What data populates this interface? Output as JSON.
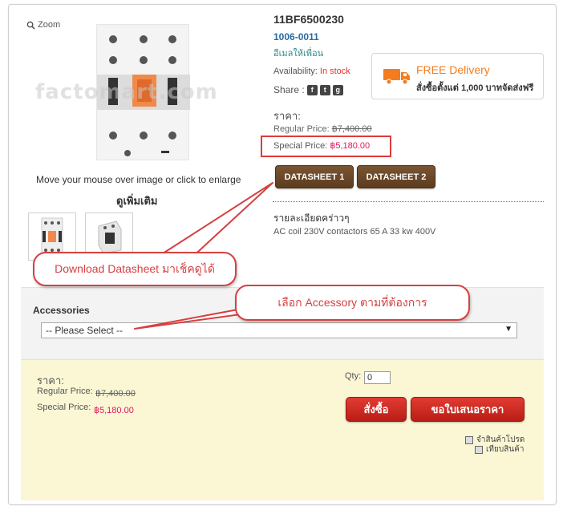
{
  "image": {
    "zoom_label": "Zoom",
    "watermark": "factomart.com",
    "enlarge_hint": "Move your mouse over image or click to enlarge",
    "more_link": "ดูเพิ่มเติม"
  },
  "product": {
    "sku": "11BF6500230",
    "code": "1006-0011",
    "email_friend": "อีเมลให้เพื่อน",
    "availability_label": "Availability:",
    "availability_value": "In stock",
    "share_label": "Share :",
    "price_heading": "ราคา:",
    "regular_label": "Regular Price:",
    "regular_value": "฿7,400.00",
    "special_label": "Special Price:",
    "special_value": "฿5,180.00"
  },
  "delivery": {
    "title": "FREE Delivery",
    "subtitle": "สั่งซื้อตั้งแต่ 1,000 บาทจัดส่งฟรี"
  },
  "datasheets": {
    "btn1": "DATASHEET 1",
    "btn2": "DATASHEET 2"
  },
  "details": {
    "title": "รายละเอียดคร่าวๆ",
    "text": "AC coil 230V contactors 65 A 33 kw 400V"
  },
  "accessories": {
    "label": "Accessories",
    "selected": "-- Please Select --"
  },
  "cart": {
    "price_heading": "ราคา:",
    "regular_label": "Regular Price:",
    "regular_value": "฿7,400.00",
    "special_label": "Special Price:",
    "special_value": "฿5,180.00",
    "qty_label": "Qty:",
    "qty_value": "0",
    "order_button": "สั่งซื้อ",
    "quote_button": "ขอใบเสนอราคา",
    "wishlist_link": "จำสินค้าโปรด",
    "compare_link": "เทียบสินค้า"
  },
  "callouts": {
    "datasheet": "Download Datasheet มาเช็คดูได้",
    "accessory": "เลือก Accessory ตามที่ต้องการ"
  },
  "colors": {
    "accent_orange": "#f47c20",
    "special_price": "#e2175b",
    "callout_red": "#d64040",
    "datasheet_brown": "#6b4628",
    "cart_bg": "#fbf7d5"
  }
}
